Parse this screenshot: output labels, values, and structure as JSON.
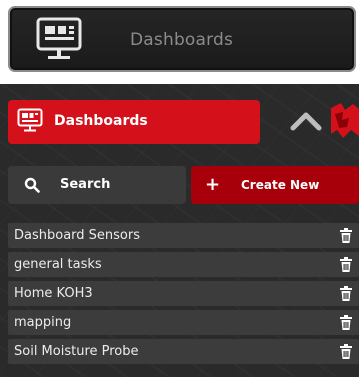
{
  "top_menu": {
    "label": "Dashboards",
    "icon": "dashboard-monitor-icon"
  },
  "panel": {
    "dashboards_button": {
      "label": "Dashboards",
      "icon": "dashboard-monitor-icon"
    },
    "collapse_icon": "chevron-up-icon",
    "brand_icon": "red-brand-logo-icon",
    "search": {
      "label": "Search",
      "icon": "search-icon"
    },
    "create_new": {
      "label": "Create New",
      "icon": "plus-icon"
    },
    "dashboards": [
      {
        "name": "Dashboard Sensors"
      },
      {
        "name": "general tasks"
      },
      {
        "name": "Home KOH3"
      },
      {
        "name": "mapping"
      },
      {
        "name": "Soil Moisture Probe"
      }
    ],
    "row_action_icon": "trash-icon",
    "colors": {
      "accent_red": "#d4101a",
      "create_red": "#a8000a",
      "panel_bg": "#2a2a2a",
      "row_bg": "#3c3c3c"
    }
  }
}
